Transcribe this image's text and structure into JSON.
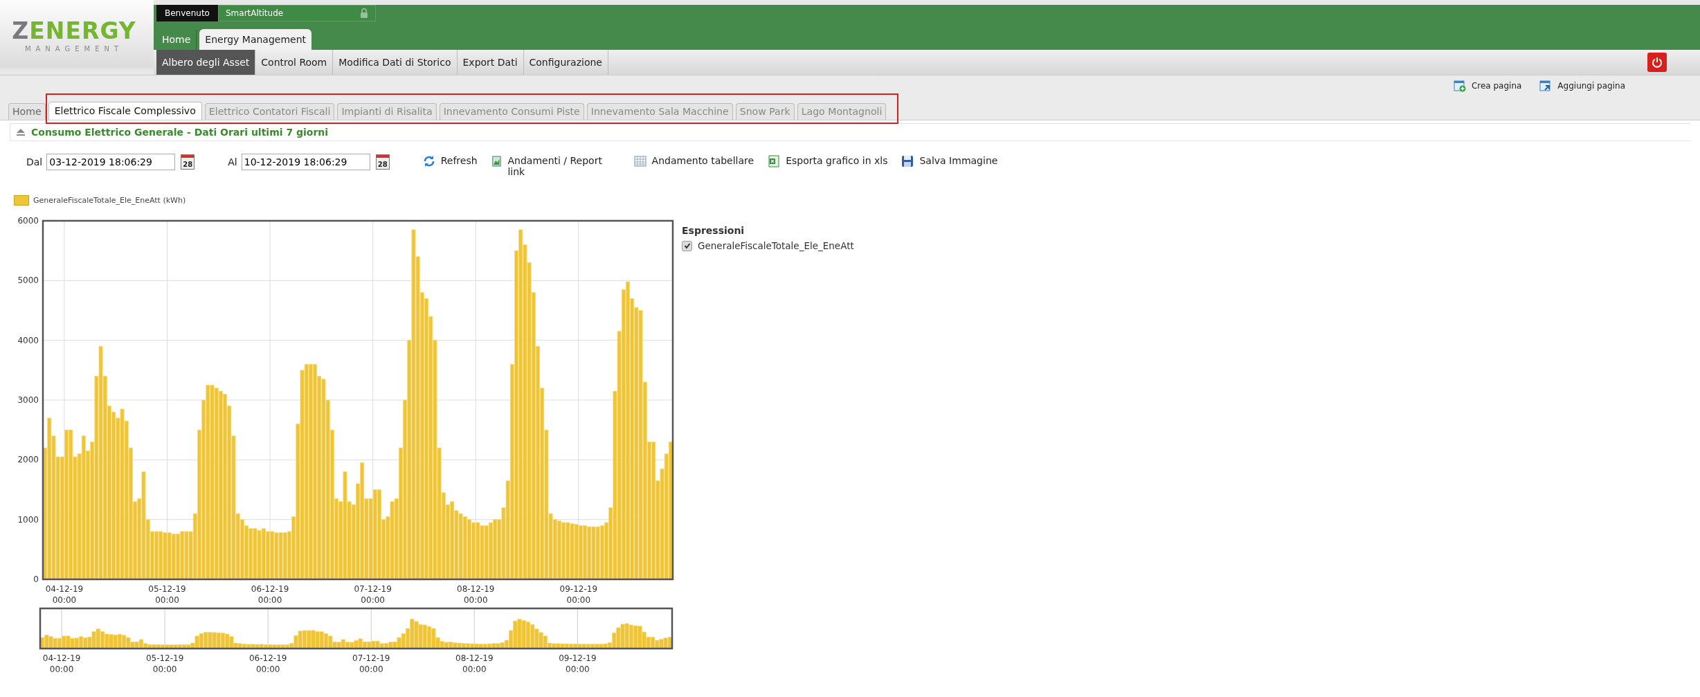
{
  "logo": {
    "name": "ZENERGY",
    "tagline": "MANAGEMENT"
  },
  "user_bar": {
    "greeting": "Benvenuto",
    "user": "SmartAltitude"
  },
  "main_tabs": [
    {
      "label": "Home",
      "selected": false
    },
    {
      "label": "Energy Management",
      "selected": true
    }
  ],
  "sub_menu": [
    {
      "label": "Albero degli Asset",
      "selected": true
    },
    {
      "label": "Control Room",
      "selected": false
    },
    {
      "label": "Modifica Dati di Storico",
      "selected": false
    },
    {
      "label": "Export Dati",
      "selected": false
    },
    {
      "label": "Configurazione",
      "selected": false
    }
  ],
  "page_actions": [
    {
      "kind": "create",
      "label": "Crea pagina"
    },
    {
      "kind": "add",
      "label": "Aggiungi pagina"
    }
  ],
  "page_tabs": [
    {
      "label": "Home",
      "selected": false
    },
    {
      "label": "Elettrico Fiscale Complessivo",
      "selected": true
    },
    {
      "label": "Elettrico Contatori Fiscali",
      "selected": false
    },
    {
      "label": "Impianti di Risalita",
      "selected": false
    },
    {
      "label": "Innevamento Consumi Piste",
      "selected": false
    },
    {
      "label": "Innevamento Sala Macchine",
      "selected": false
    },
    {
      "label": "Snow Park",
      "selected": false
    },
    {
      "label": "Lago Montagnoli",
      "selected": false
    }
  ],
  "panel": {
    "title": "Consumo Elettrico Generale - Dati Orari ultimi 7 giorni",
    "from": {
      "label": "Dal",
      "value": "03-12-2019 18:06:29",
      "calendar_day": "28"
    },
    "to": {
      "label": "Al",
      "value": "10-12-2019 18:06:29",
      "calendar_day": "28"
    },
    "actions": [
      {
        "kind": "refresh",
        "label": "Refresh"
      },
      {
        "kind": "report",
        "label": "Andamenti / Report link"
      },
      {
        "kind": "table",
        "label": "Andamento tabellare"
      },
      {
        "kind": "excel",
        "label": "Esporta grafico in xls"
      },
      {
        "kind": "save",
        "label": "Salva Immagine"
      }
    ],
    "chart_data": {
      "type": "bar",
      "grid": true,
      "ylim": [
        0,
        6000
      ],
      "categories": [
        null,
        null,
        null,
        null,
        null,
        "04-12-19 00:00",
        null,
        null,
        null,
        null,
        null,
        null,
        null,
        null,
        null,
        null,
        null,
        null,
        null,
        null,
        null,
        null,
        null,
        null,
        null,
        null,
        null,
        null,
        null,
        "05-12-19 00:00",
        null,
        null,
        null,
        null,
        null,
        null,
        null,
        null,
        null,
        null,
        null,
        null,
        null,
        null,
        null,
        null,
        null,
        null,
        null,
        null,
        null,
        null,
        null,
        "06-12-19 00:00",
        null,
        null,
        null,
        null,
        null,
        null,
        null,
        null,
        null,
        null,
        null,
        null,
        null,
        null,
        null,
        null,
        null,
        null,
        null,
        null,
        null,
        null,
        null,
        "07-12-19 00:00",
        null,
        null,
        null,
        null,
        null,
        null,
        null,
        null,
        null,
        null,
        null,
        null,
        null,
        null,
        null,
        null,
        null,
        null,
        null,
        null,
        null,
        null,
        null,
        "08-12-19 00:00",
        null,
        null,
        null,
        null,
        null,
        null,
        null,
        null,
        null,
        null,
        null,
        null,
        null,
        null,
        null,
        null,
        null,
        null,
        null,
        null,
        null,
        null,
        null,
        "09-12-19 00:00",
        null,
        null,
        null,
        null,
        null,
        null,
        null,
        null,
        null,
        null,
        null,
        null,
        null,
        null,
        null,
        null,
        null,
        null,
        null,
        null,
        null
      ],
      "yticks": [
        0,
        1000,
        2000,
        3000,
        4000,
        5000,
        6000
      ],
      "series": [
        {
          "name": "GeneraleFiscaleTotale_Ele_EneAtt (kWh)",
          "color": "#efc437",
          "values": [
            2200,
            2700,
            2400,
            2050,
            2050,
            2500,
            2500,
            2050,
            2100,
            2400,
            2150,
            2300,
            3400,
            3900,
            3400,
            2900,
            2800,
            2700,
            2850,
            2650,
            2200,
            1300,
            1350,
            1800,
            1000,
            800,
            800,
            800,
            780,
            780,
            760,
            760,
            800,
            800,
            800,
            1100,
            2500,
            3000,
            3250,
            3250,
            3200,
            3150,
            3100,
            2900,
            2400,
            1100,
            1000,
            900,
            850,
            850,
            820,
            850,
            800,
            800,
            780,
            780,
            780,
            800,
            1050,
            2600,
            3500,
            3600,
            3600,
            3600,
            3400,
            3350,
            3000,
            2500,
            1350,
            1300,
            1800,
            1300,
            1250,
            1600,
            1950,
            1350,
            1350,
            1500,
            1500,
            1000,
            1050,
            1300,
            1350,
            2200,
            3000,
            4000,
            5850,
            5400,
            4800,
            4700,
            4400,
            4000,
            2200,
            1450,
            1250,
            1300,
            1150,
            1100,
            1050,
            1000,
            950,
            950,
            900,
            900,
            950,
            1000,
            1000,
            1200,
            1650,
            3600,
            5500,
            5850,
            5600,
            5300,
            4800,
            3900,
            3200,
            2500,
            1100,
            1000,
            980,
            950,
            950,
            930,
            920,
            900,
            900,
            880,
            880,
            880,
            900,
            950,
            1200,
            3150,
            4150,
            4850,
            4980,
            4700,
            4550,
            4500,
            3300,
            2300,
            2300,
            1650,
            1850,
            2100,
            2300
          ]
        }
      ]
    }
  },
  "navigator": {
    "xtick_labels": [
      "04-12-19 00:00",
      "05-12-19 00:00",
      "06-12-19 00:00",
      "07-12-19 00:00",
      "08-12-19 00:00",
      "09-12-19 00:00"
    ]
  },
  "expressions": {
    "title": "Espressioni",
    "items": [
      {
        "label": "GeneraleFiscaleTotale_Ele_EneAtt",
        "checked": true
      }
    ]
  }
}
